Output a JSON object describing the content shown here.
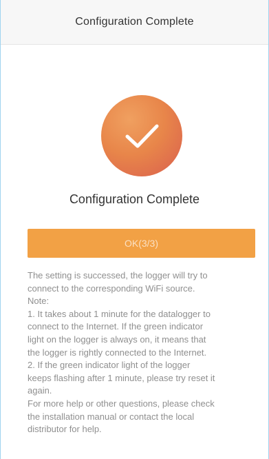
{
  "header": {
    "title": "Configuration Complete"
  },
  "status": {
    "icon": "check-icon",
    "circle_color": "#e8864a",
    "title": "Configuration Complete"
  },
  "ok_button": {
    "label": "OK(3/3)",
    "color": "#f2a145"
  },
  "message": {
    "lines": [
      "The setting is successed, the logger will try to",
      "connect to the corresponding WiFi source.",
      "Note:",
      "1. It takes about 1 minute for the datalogger to",
      "connect to the Internet. If the green indicator",
      "light on the logger is always on, it means that",
      "the logger is rightly connected to the Internet.",
      "2. If the green  indicator light of the logger",
      "keeps flashing after 1 minute, please try reset it",
      "again.",
      "For more help or other questions, please check",
      "the installation manual or contact the local",
      "distributor for help."
    ]
  }
}
